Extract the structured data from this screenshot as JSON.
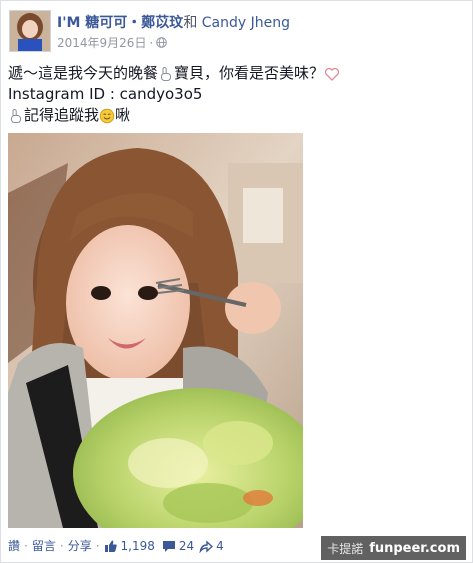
{
  "post": {
    "author": "I'M 糖可可・鄭苡玟",
    "and_text": "和",
    "with_name": "Candy Jheng",
    "date": "2014年9月26日",
    "meta_sep": "·",
    "privacy_icon": "globe-icon",
    "lines": [
      {
        "text": "遞～這是我今天的晚餐",
        "icon": "hand-point-icon",
        "after": "寶貝，你看是否美味？",
        "end_icon": "heart-icon"
      },
      {
        "text": "Instagram ID : candyo3o5"
      },
      {
        "icon": "hand-point-icon",
        "text": "記得追蹤我",
        "mid_icon": "smile-emoji-icon",
        "after": "啾"
      }
    ]
  },
  "actions": {
    "like_label": "讚",
    "comment_label": "留言",
    "share_label": "分享",
    "dot": "·",
    "likes": "1,198",
    "comments": "24",
    "shares": "4"
  },
  "watermark": {
    "left_text": "卡提諾",
    "brand": "funpeer.com"
  },
  "colors": {
    "link": "#3b5998",
    "meta": "#9197a3",
    "text": "#141823"
  }
}
